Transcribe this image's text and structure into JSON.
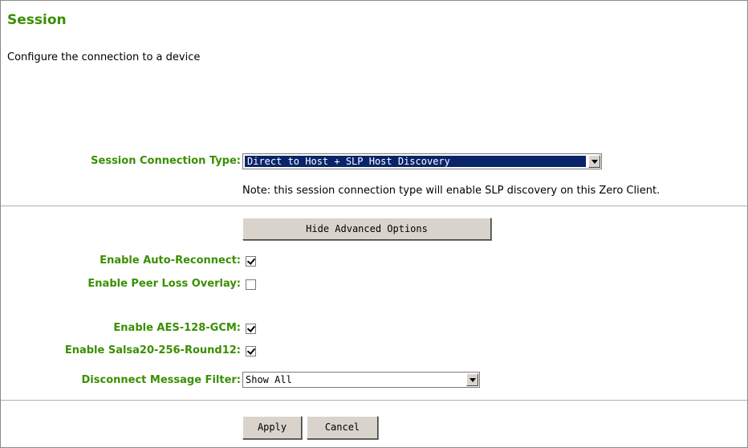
{
  "page": {
    "title": "Session",
    "description": "Configure the connection to a device"
  },
  "session_connection_type": {
    "label": "Session Connection Type:",
    "value": "Direct to Host + SLP Host Discovery",
    "note": "Note: this session connection type will enable SLP discovery on this Zero Client."
  },
  "advanced_toggle_label": "Hide Advanced Options",
  "options": {
    "auto_reconnect": {
      "label": "Enable Auto-Reconnect:",
      "checked": true
    },
    "peer_loss_overlay": {
      "label": "Enable Peer Loss Overlay:",
      "checked": false
    },
    "aes_128_gcm": {
      "label": "Enable AES-128-GCM:",
      "checked": true
    },
    "salsa20": {
      "label": "Enable Salsa20-256-Round12:",
      "checked": true
    }
  },
  "disconnect_filter": {
    "label": "Disconnect Message Filter:",
    "value": "Show All"
  },
  "actions": {
    "apply": "Apply",
    "cancel": "Cancel"
  },
  "colors": {
    "label_green": "#3a8f00",
    "selection_navy": "#0a246a",
    "button_face": "#d8d4cc"
  }
}
